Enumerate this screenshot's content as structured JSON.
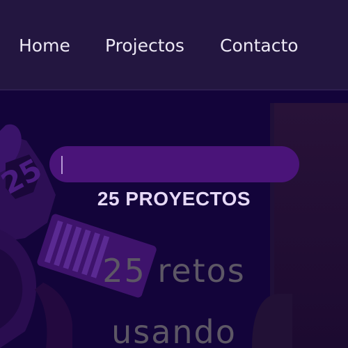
{
  "nav": {
    "items": [
      {
        "label": "Home"
      },
      {
        "label": "Projectos"
      },
      {
        "label": "Contacto"
      }
    ]
  },
  "hero": {
    "search": {
      "value": ""
    },
    "eyebrow": "25 PROYECTOS",
    "title_line1": "25 retos",
    "title_line2": "usando"
  },
  "colors": {
    "navbar_bg": "#231640",
    "hero_bg": "#13043a",
    "search_pill": "#4a1479",
    "eyebrow_text": "#e7d9f7",
    "title_text": "#5d5765"
  }
}
